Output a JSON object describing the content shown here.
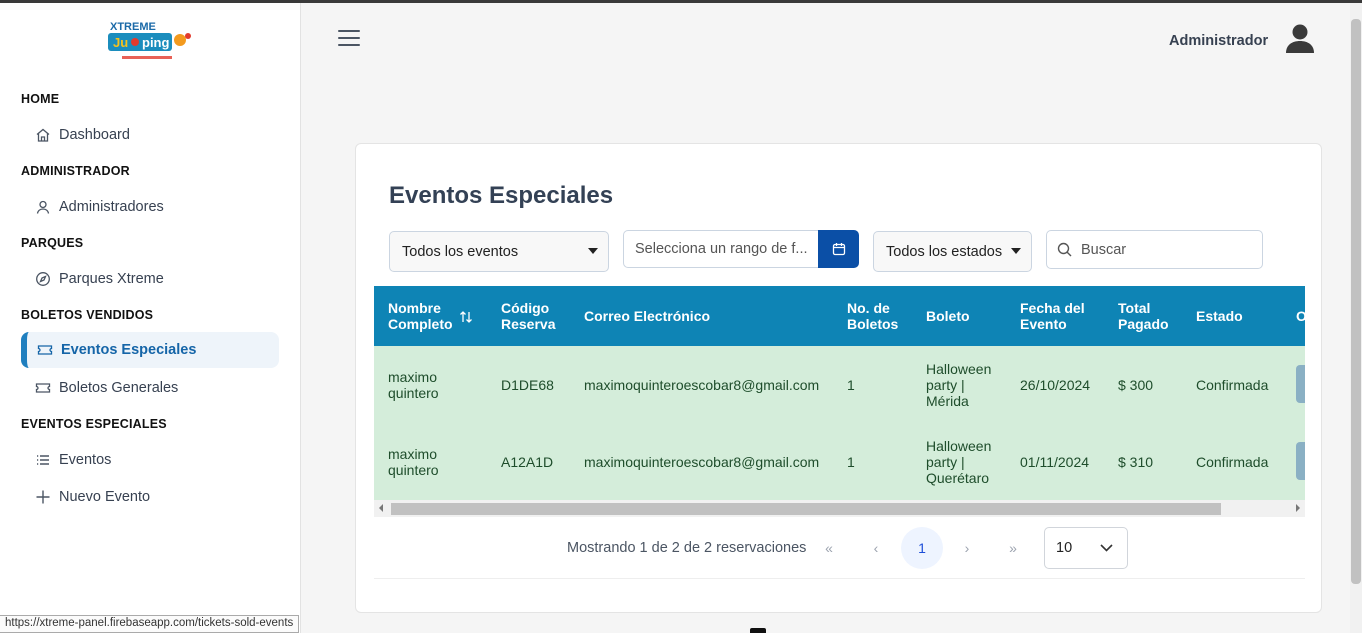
{
  "app": {
    "logo_alt": "Xtreme Jumping - Un salto a la diversión",
    "status_url": "https://xtreme-panel.firebaseapp.com/tickets-sold-events"
  },
  "sidebar": {
    "sections": [
      {
        "title": "HOME",
        "items": [
          {
            "label": "Dashboard",
            "icon": "home-icon"
          }
        ]
      },
      {
        "title": "ADMINISTRADOR",
        "items": [
          {
            "label": "Administradores",
            "icon": "user-icon"
          }
        ]
      },
      {
        "title": "PARQUES",
        "items": [
          {
            "label": "Parques Xtreme",
            "icon": "compass-icon"
          }
        ]
      },
      {
        "title": "BOLETOS VENDIDOS",
        "items": [
          {
            "label": "Eventos Especiales",
            "icon": "ticket-icon",
            "active": true
          },
          {
            "label": "Boletos Generales",
            "icon": "ticket-icon"
          }
        ]
      },
      {
        "title": "EVENTOS ESPECIALES",
        "items": [
          {
            "label": "Eventos",
            "icon": "list-icon"
          },
          {
            "label": "Nuevo Evento",
            "icon": "plus-icon"
          }
        ]
      }
    ]
  },
  "header": {
    "user_name": "Administrador"
  },
  "main": {
    "title": "Eventos Especiales",
    "filters": {
      "event_select": "Todos los eventos",
      "date_placeholder": "Selecciona un rango de f...",
      "status_select": "Todos los estados",
      "search_placeholder": "Buscar"
    },
    "table": {
      "columns": [
        "Nombre Completo",
        "Código Reserva",
        "Correo Electrónico",
        "No. de Boletos",
        "Boleto",
        "Fecha del Evento",
        "Total Pagado",
        "Estado",
        "O"
      ],
      "rows": [
        {
          "nombre": "maximo quintero",
          "codigo": "D1DE68",
          "correo": "maximoquinteroescobar8@gmail.com",
          "boletos": "1",
          "boleto": "Halloween party | Mérida",
          "fecha": "26/10/2024",
          "total": "$ 300",
          "estado": "Confirmada"
        },
        {
          "nombre": "maximo quintero",
          "codigo": "A12A1D",
          "correo": "maximoquinteroescobar8@gmail.com",
          "boletos": "1",
          "boleto": "Halloween party | Querétaro",
          "fecha": "01/11/2024",
          "total": "$ 310",
          "estado": "Confirmada"
        }
      ]
    },
    "pagination": {
      "summary": "Mostrando 1 de 2 de 2 reservaciones",
      "first": "«",
      "prev": "‹",
      "current_page": "1",
      "next": "›",
      "last": "»",
      "rows_per_page": "10"
    }
  },
  "colors": {
    "header_bg": "#0e84b5",
    "row_bg": "#d4edda",
    "accent": "#1f7fbf",
    "date_button": "#0b4fa6"
  }
}
